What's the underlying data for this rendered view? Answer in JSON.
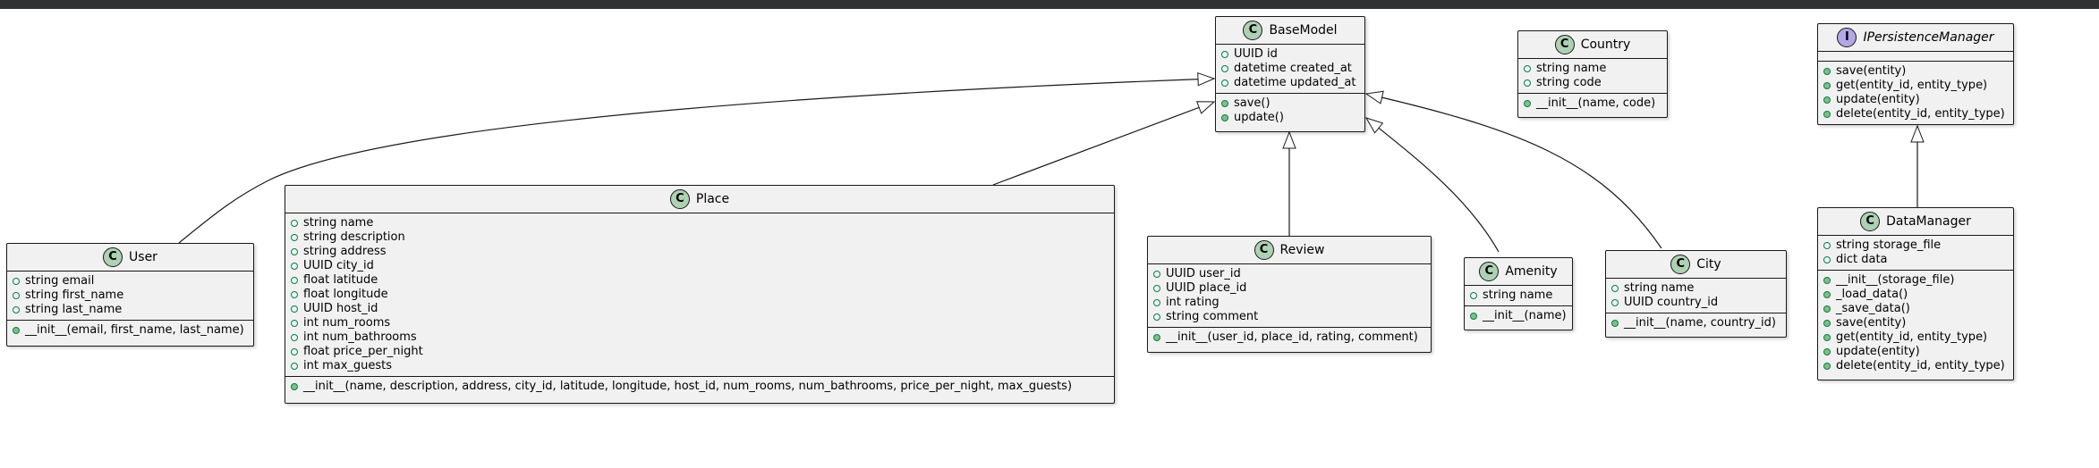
{
  "colors": {
    "class_badge": "#add1b2",
    "interface_badge": "#b4a7e5",
    "box_fill": "#f1f1f1",
    "border": "#181818",
    "visibility_green": "#038048"
  },
  "icons": {
    "class": "C",
    "interface": "I"
  },
  "classes": {
    "basemodel": {
      "name": "BaseModel",
      "fields": [
        "UUID id",
        "datetime created_at",
        "datetime updated_at"
      ],
      "methods": [
        "save()",
        "update()"
      ]
    },
    "country": {
      "name": "Country",
      "fields": [
        "string name",
        "string code"
      ],
      "methods": [
        "__init__(name, code)"
      ]
    },
    "ipersistence": {
      "name": "IPersistenceManager",
      "fields": [],
      "methods": [
        "save(entity)",
        "get(entity_id, entity_type)",
        "update(entity)",
        "delete(entity_id, entity_type)"
      ]
    },
    "user": {
      "name": "User",
      "fields": [
        "string email",
        "string first_name",
        "string last_name"
      ],
      "methods": [
        "__init__(email, first_name, last_name)"
      ]
    },
    "place": {
      "name": "Place",
      "fields": [
        "string name",
        "string description",
        "string address",
        "UUID city_id",
        "float latitude",
        "float longitude",
        "UUID host_id",
        "int num_rooms",
        "int num_bathrooms",
        "float price_per_night",
        "int max_guests"
      ],
      "methods": [
        "__init__(name, description, address, city_id, latitude, longitude, host_id, num_rooms, num_bathrooms, price_per_night, max_guests)"
      ]
    },
    "review": {
      "name": "Review",
      "fields": [
        "UUID user_id",
        "UUID place_id",
        "int rating",
        "string comment"
      ],
      "methods": [
        "__init__(user_id, place_id, rating, comment)"
      ]
    },
    "amenity": {
      "name": "Amenity",
      "fields": [
        "string name"
      ],
      "methods": [
        "__init__(name)"
      ]
    },
    "city": {
      "name": "City",
      "fields": [
        "string name",
        "UUID country_id"
      ],
      "methods": [
        "__init__(name, country_id)"
      ]
    },
    "datamanager": {
      "name": "DataManager",
      "fields": [
        "string storage_file",
        "dict data"
      ],
      "methods": [
        "__init__(storage_file)",
        "_load_data()",
        "_save_data()",
        "save(entity)",
        "get(entity_id, entity_type)",
        "update(entity)",
        "delete(entity_id, entity_type)"
      ]
    }
  }
}
